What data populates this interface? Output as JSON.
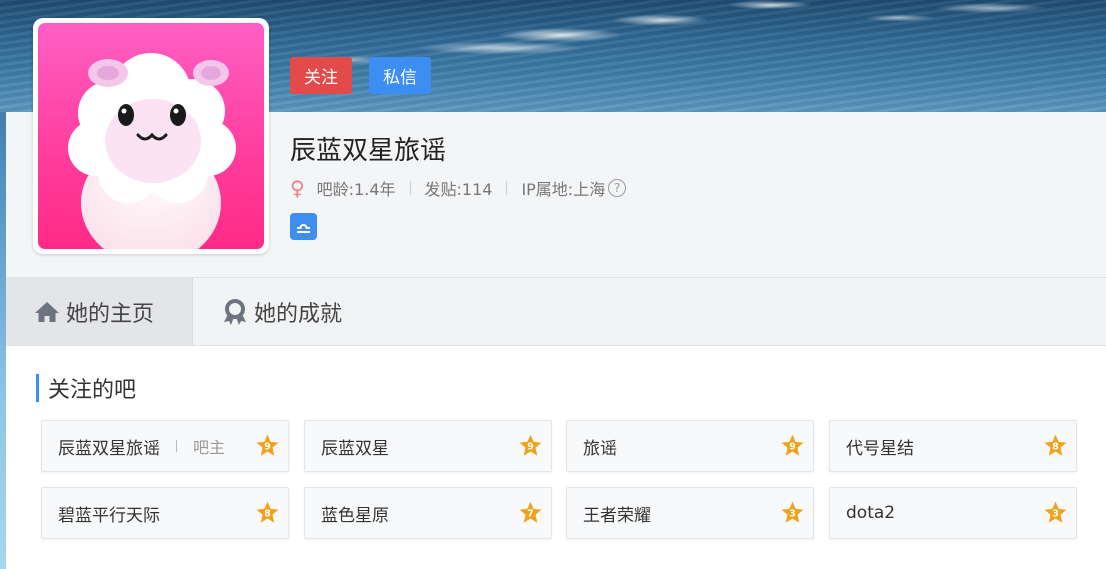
{
  "profile": {
    "follow_label": "关注",
    "message_label": "私信",
    "username": "辰蓝双星旅谣",
    "age": "吧龄:1.4年",
    "posts": "发贴:114",
    "ip": "IP属地:上海",
    "help": "?"
  },
  "tabs": [
    {
      "label": "她的主页",
      "icon": "home-icon"
    },
    {
      "label": "她的成就",
      "icon": "badge-icon"
    }
  ],
  "section": {
    "title": "关注的吧"
  },
  "tieba": [
    {
      "name": "辰蓝双星旅谣",
      "owner": "吧主",
      "level": "9"
    },
    {
      "name": "辰蓝双星",
      "owner": "",
      "level": "9"
    },
    {
      "name": "旅谣",
      "owner": "",
      "level": "9"
    },
    {
      "name": "代号星结",
      "owner": "",
      "level": "8"
    },
    {
      "name": "碧蓝平行天际",
      "owner": "",
      "level": "8"
    },
    {
      "name": "蓝色星原",
      "owner": "",
      "level": "7"
    },
    {
      "name": "王者荣耀",
      "owner": "",
      "level": "3"
    },
    {
      "name": "dota2",
      "owner": "",
      "level": "3"
    }
  ],
  "colors": {
    "accent": "#3c8ef2",
    "follow": "#e34a4a",
    "star": "#f0a21c",
    "gender": "#f47a86"
  }
}
